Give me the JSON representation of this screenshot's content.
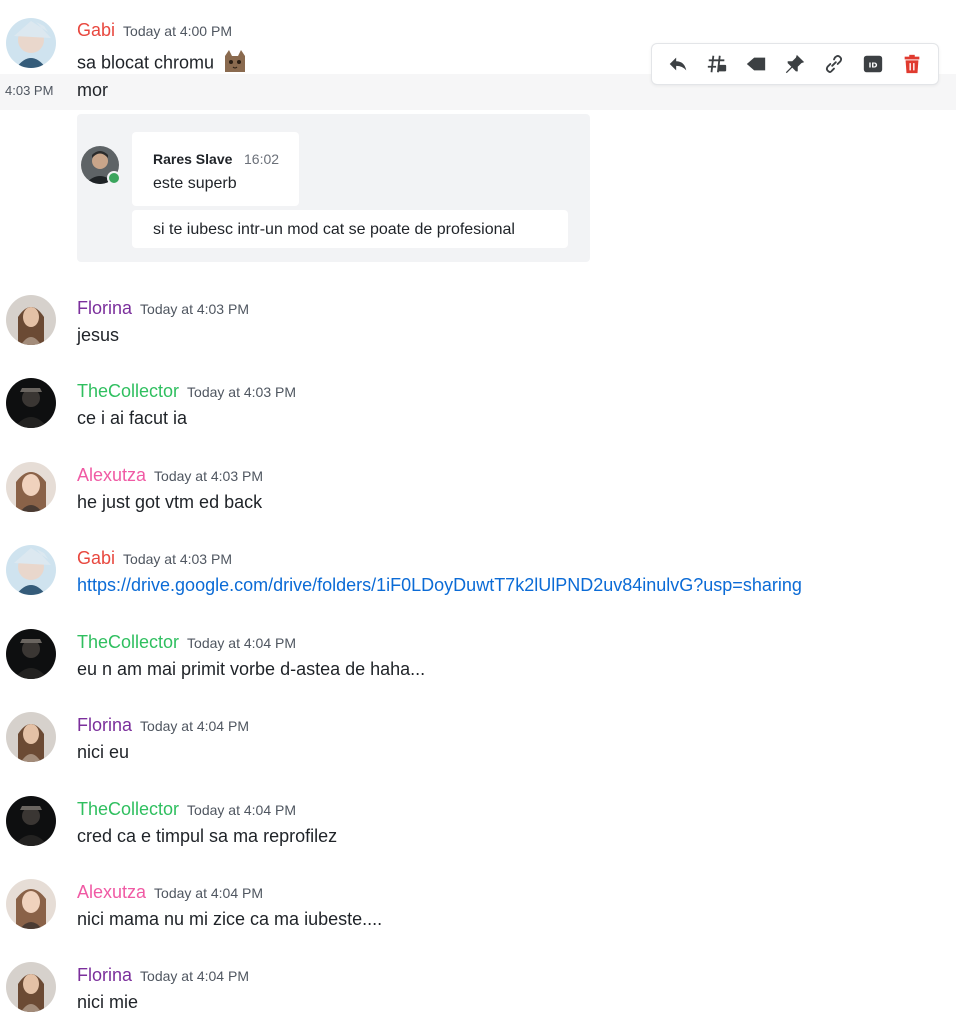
{
  "colors": {
    "gabi": "#e8483f",
    "florina": "#7b2f9c",
    "thecollector": "#2fbf5f",
    "alexutza": "#f05aa4",
    "link": "#0b6bd6",
    "delete": "#e03a2f"
  },
  "toolbar": {
    "icons": [
      "reply-icon",
      "thread-icon",
      "tag-icon",
      "pin-icon",
      "link-icon",
      "id-icon",
      "trash-icon"
    ],
    "id_label": "ID"
  },
  "hovered_message": {
    "timestamp": "4:03 PM",
    "text": "mor"
  },
  "embed": {
    "author": "Rares Slave",
    "time": "16:02",
    "lines": [
      "este superb",
      "si te iubesc intr-un mod cat se poate de profesional"
    ]
  },
  "messages": [
    {
      "author": "Gabi",
      "time": "Today at 4:00 PM",
      "text": "sa blocat chromu",
      "avatar": "gabi",
      "emoji": "cat-emoji"
    },
    {
      "author": "Florina",
      "time": "Today at 4:03 PM",
      "text": "jesus",
      "avatar": "florina"
    },
    {
      "author": "TheCollector",
      "time": "Today at 4:03 PM",
      "text": "ce i ai facut ia",
      "avatar": "collector"
    },
    {
      "author": "Alexutza",
      "time": "Today at 4:03 PM",
      "text": "he just got vtm ed back",
      "avatar": "alexutza"
    },
    {
      "author": "Gabi",
      "time": "Today at 4:03 PM",
      "text": "https://drive.google.com/drive/folders/1iF0LDoyDuwtT7k2lUlPND2uv84inulvG?usp=sharing",
      "avatar": "gabi",
      "link": true
    },
    {
      "author": "TheCollector",
      "time": "Today at 4:04 PM",
      "text": "eu n am mai primit vorbe d-astea de haha...",
      "avatar": "collector"
    },
    {
      "author": "Florina",
      "time": "Today at 4:04 PM",
      "text": "nici eu",
      "avatar": "florina"
    },
    {
      "author": "TheCollector",
      "time": "Today at 4:04 PM",
      "text": "cred ca e timpul sa ma reprofilez",
      "avatar": "collector"
    },
    {
      "author": "Alexutza",
      "time": "Today at 4:04 PM",
      "text": "nici mama nu mi zice ca ma iubeste....",
      "avatar": "alexutza"
    },
    {
      "author": "Florina",
      "time": "Today at 4:04 PM",
      "text": "nici mie",
      "avatar": "florina"
    }
  ]
}
